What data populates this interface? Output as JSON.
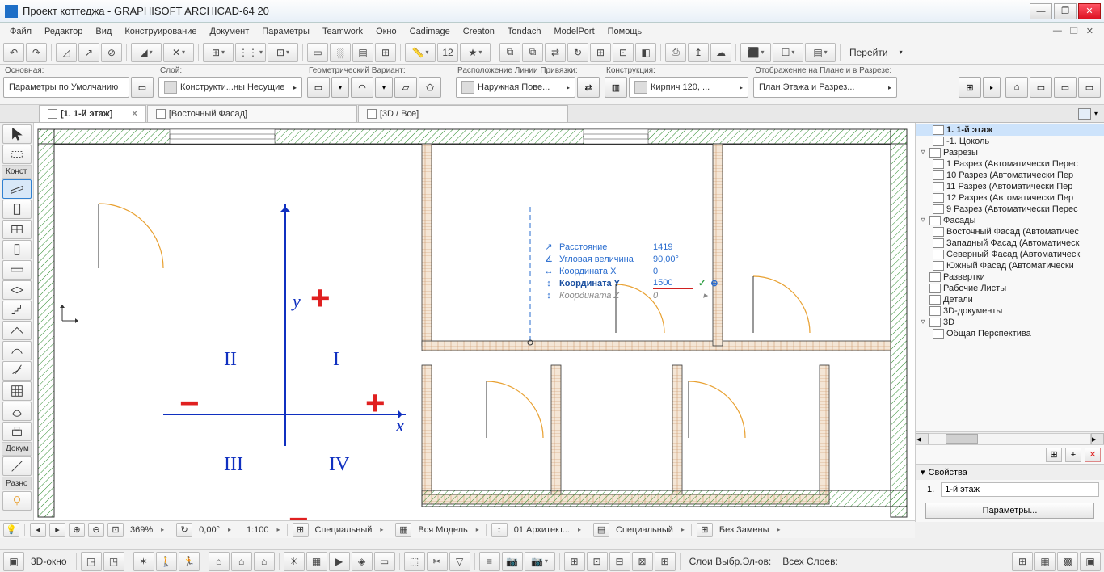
{
  "title": "Проект коттеджа - GRAPHISOFT ARCHICAD-64 20",
  "menu": [
    "Файл",
    "Редактор",
    "Вид",
    "Конструирование",
    "Документ",
    "Параметры",
    "Teamwork",
    "Окно",
    "Cadimage",
    "Creaton",
    "Tondach",
    "ModelPort",
    "Помощь"
  ],
  "toolbar1": {
    "goto": "Перейти"
  },
  "infobar": {
    "main_label": "Основная:",
    "default_params": "Параметры по Умолчанию",
    "layer_label": "Слой:",
    "layer_value": "Конструкти...ны Несущие",
    "geom_label": "Геометрический Вариант:",
    "refline_label": "Расположение Линии Привязки:",
    "refline_value": "Наружная Пове...",
    "constr_label": "Конструкция:",
    "constr_value": "Кирпич 120, ...",
    "display_label": "Отображение на Плане и в Разрезе:",
    "display_value": "План Этажа и Разрез..."
  },
  "tabs": [
    {
      "label": "[1. 1-й этаж]",
      "active": true,
      "closable": true
    },
    {
      "label": "[Восточный Фасад]",
      "active": false,
      "closable": false
    },
    {
      "label": "[3D / Все]",
      "active": false,
      "closable": false
    }
  ],
  "toolbox": {
    "groups": [
      "Конст",
      "Докум",
      "Разно"
    ]
  },
  "navigator": {
    "items": [
      {
        "label": "1. 1-й этаж",
        "lvl": 1,
        "sel": true
      },
      {
        "label": "-1. Цоколь",
        "lvl": 1
      },
      {
        "label": "Разрезы",
        "lvl": 0,
        "exp": "▿"
      },
      {
        "label": "1 Разрез (Автоматически Перес",
        "lvl": 1
      },
      {
        "label": "10 Разрез (Автоматически Пер",
        "lvl": 1
      },
      {
        "label": "11 Разрез (Автоматически Пер",
        "lvl": 1
      },
      {
        "label": "12 Разрез (Автоматически Пер",
        "lvl": 1
      },
      {
        "label": "9 Разрез (Автоматически Перес",
        "lvl": 1
      },
      {
        "label": "Фасады",
        "lvl": 0,
        "exp": "▿"
      },
      {
        "label": "Восточный Фасад (Автоматичес",
        "lvl": 1
      },
      {
        "label": "Западный Фасад (Автоматическ",
        "lvl": 1
      },
      {
        "label": "Северный Фасад (Автоматическ",
        "lvl": 1
      },
      {
        "label": "Южный Фасад (Автоматически",
        "lvl": 1
      },
      {
        "label": "Развертки",
        "lvl": 0
      },
      {
        "label": "Рабочие Листы",
        "lvl": 0
      },
      {
        "label": "Детали",
        "lvl": 0
      },
      {
        "label": "3D-документы",
        "lvl": 0
      },
      {
        "label": "3D",
        "lvl": 0,
        "exp": "▿"
      },
      {
        "label": "Общая Перспектива",
        "lvl": 1
      }
    ],
    "props_label": "Свойства",
    "props_floor_num": "1.",
    "props_floor_name": "1-й этаж",
    "params_btn": "Параметры..."
  },
  "tracker": {
    "rows": [
      {
        "icon": "↗",
        "label": "Расстояние",
        "value": "1419"
      },
      {
        "icon": "∡",
        "label": "Угловая величина",
        "value": "90,00°"
      },
      {
        "icon": "↔",
        "label": "Координата X",
        "value": "0"
      },
      {
        "icon": "↕",
        "label": "Координата Y",
        "value": "1500",
        "hl": true
      },
      {
        "icon": "↕",
        "label": "Координата Z",
        "value": "0",
        "dim": true
      }
    ]
  },
  "coords": {
    "y": "y",
    "x": "x",
    "q1": "I",
    "q2": "II",
    "q3": "III",
    "q4": "IV",
    "plus": "+",
    "minus": "−"
  },
  "quickbar": {
    "zoom": "369%",
    "zoom_dd": "▸",
    "angle": "0,00°",
    "angle_dd": "▸",
    "scale": "1:100",
    "scale_dd": "▸",
    "disp": "Специальный",
    "disp_dd": "▸",
    "model": "Вся Модель",
    "model_dd": "▸",
    "arch": "01 Архитект...",
    "arch_dd": "▸",
    "spec2": "Специальный",
    "spec2_dd": "▸",
    "repl": "Без Замены",
    "repl_dd": "▸"
  },
  "bottombar": {
    "win3d": "3D-окно",
    "layers_sel": "Слои Выбр.Эл-ов:",
    "layers_all": "Всех Слоев:"
  }
}
